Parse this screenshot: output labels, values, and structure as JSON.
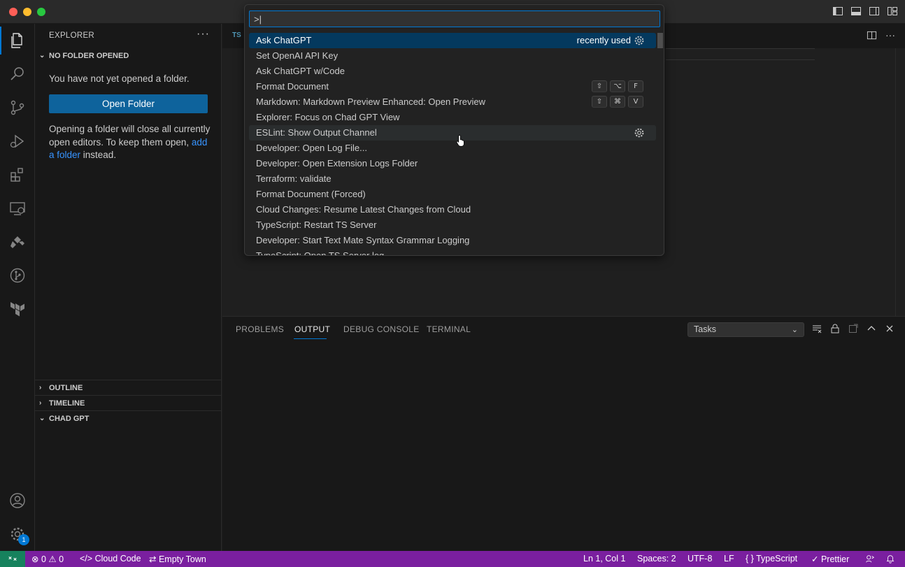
{
  "colors": {
    "accent": "#0078d4",
    "statusbar": "#7a1f9f",
    "remote": "#16825d",
    "link": "#3794ff",
    "button": "#0e639c"
  },
  "sidebar": {
    "title": "EXPLORER",
    "more": "···",
    "no_folder_header": "NO FOLDER OPENED",
    "empty_message": "You have not yet opened a folder.",
    "open_folder_button": "Open Folder",
    "hint_before": "Opening a folder will close all currently open editors. To keep them open, ",
    "hint_link": "add a folder",
    "hint_after": " instead.",
    "outline": "OUTLINE",
    "timeline": "TIMELINE",
    "chad_gpt": "CHAD GPT"
  },
  "editor": {
    "tab_badge": "TS"
  },
  "palette": {
    "input_value": ">|",
    "items": [
      {
        "label": "Ask ChatGPT",
        "badge": "recently used",
        "gear": true,
        "selected": true
      },
      {
        "label": "Set OpenAI API Key"
      },
      {
        "label": "Ask ChatGPT w/Code"
      },
      {
        "label": "Format Document",
        "keys": [
          "⇧",
          "⌥",
          "F"
        ]
      },
      {
        "label": "Markdown: Markdown Preview Enhanced: Open Preview",
        "keys": [
          "⇧",
          "⌘",
          "V"
        ]
      },
      {
        "label": "Explorer: Focus on Chad GPT View"
      },
      {
        "label": "ESLint: Show Output Channel",
        "gear": true,
        "hover": true
      },
      {
        "label": "Developer: Open Log File..."
      },
      {
        "label": "Developer: Open Extension Logs Folder"
      },
      {
        "label": "Terraform: validate"
      },
      {
        "label": "Format Document (Forced)"
      },
      {
        "label": "Cloud Changes: Resume Latest Changes from Cloud"
      },
      {
        "label": "TypeScript: Restart TS Server"
      },
      {
        "label": "Developer: Start Text Mate Syntax Grammar Logging"
      },
      {
        "label": "TypeScript: Open TS Server log"
      }
    ]
  },
  "panel": {
    "tabs": [
      "PROBLEMS",
      "OUTPUT",
      "DEBUG CONSOLE",
      "TERMINAL"
    ],
    "active_tab": "OUTPUT",
    "select_value": "Tasks"
  },
  "statusbar": {
    "errors": "0",
    "warnings": "0",
    "cloud_code": "Cloud Code",
    "branch": "Empty Town",
    "position": "Ln 1, Col 1",
    "spaces": "Spaces: 2",
    "encoding": "UTF-8",
    "eol": "LF",
    "language": "TypeScript",
    "formatter": "Prettier"
  },
  "activitybar": {
    "settings_badge": "1"
  }
}
